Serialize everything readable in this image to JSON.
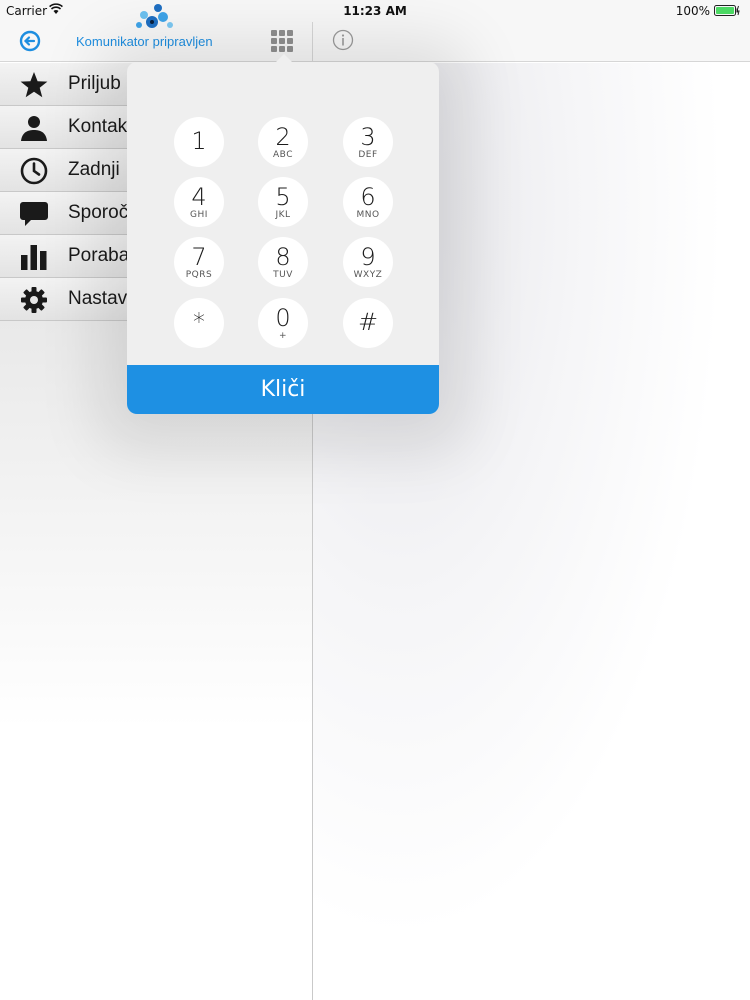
{
  "status_bar": {
    "carrier": "Carrier",
    "time": "11:23 AM",
    "battery": "100%"
  },
  "header": {
    "connection_status": "Komunikator pripravljen"
  },
  "sidebar": {
    "items": [
      {
        "label": "Priljub",
        "icon": "star-icon"
      },
      {
        "label": "Kontak",
        "icon": "person-icon"
      },
      {
        "label": "Zadnji",
        "icon": "clock-icon"
      },
      {
        "label": "Sporoč",
        "icon": "chat-bubble-icon"
      },
      {
        "label": "Poraba",
        "icon": "bar-chart-icon"
      },
      {
        "label": "Nastav",
        "icon": "gear-icon"
      }
    ]
  },
  "dialpad": {
    "keys": [
      {
        "digit": "1",
        "letters": ""
      },
      {
        "digit": "2",
        "letters": "ABC"
      },
      {
        "digit": "3",
        "letters": "DEF"
      },
      {
        "digit": "4",
        "letters": "GHI"
      },
      {
        "digit": "5",
        "letters": "JKL"
      },
      {
        "digit": "6",
        "letters": "MNO"
      },
      {
        "digit": "7",
        "letters": "PQRS"
      },
      {
        "digit": "8",
        "letters": "TUV"
      },
      {
        "digit": "9",
        "letters": "WXYZ"
      },
      {
        "digit": "*",
        "letters": ""
      },
      {
        "digit": "0",
        "letters": "+"
      },
      {
        "digit": "#",
        "letters": ""
      }
    ],
    "call_label": "Kliči"
  },
  "colors": {
    "accent": "#1e90e3",
    "battery": "#4cd964"
  }
}
